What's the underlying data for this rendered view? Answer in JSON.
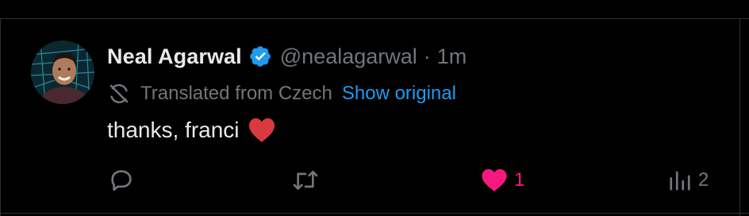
{
  "tweet": {
    "author_name": "Neal Agarwal",
    "handle": "@nealagarwal",
    "separator": "·",
    "time": "1m",
    "translation_note": "Translated from Czech",
    "show_original": "Show original",
    "text": "thanks, franci"
  },
  "actions": {
    "reply_count": "",
    "retweet_count": "",
    "like_count": "1",
    "views_count": "2"
  },
  "colors": {
    "accent": "#1d9bf0",
    "like": "#f91880",
    "muted": "#71767b",
    "verified": "#1d9bf0",
    "emoji_heart": "#d83a3f"
  },
  "icons": {
    "verified": "verified-badge-icon",
    "translate": "translate-icon",
    "heart_emoji": "red-heart-emoji",
    "reply": "reply-icon",
    "retweet": "retweet-icon",
    "like": "heart-filled-icon",
    "views": "views-chart-icon"
  }
}
